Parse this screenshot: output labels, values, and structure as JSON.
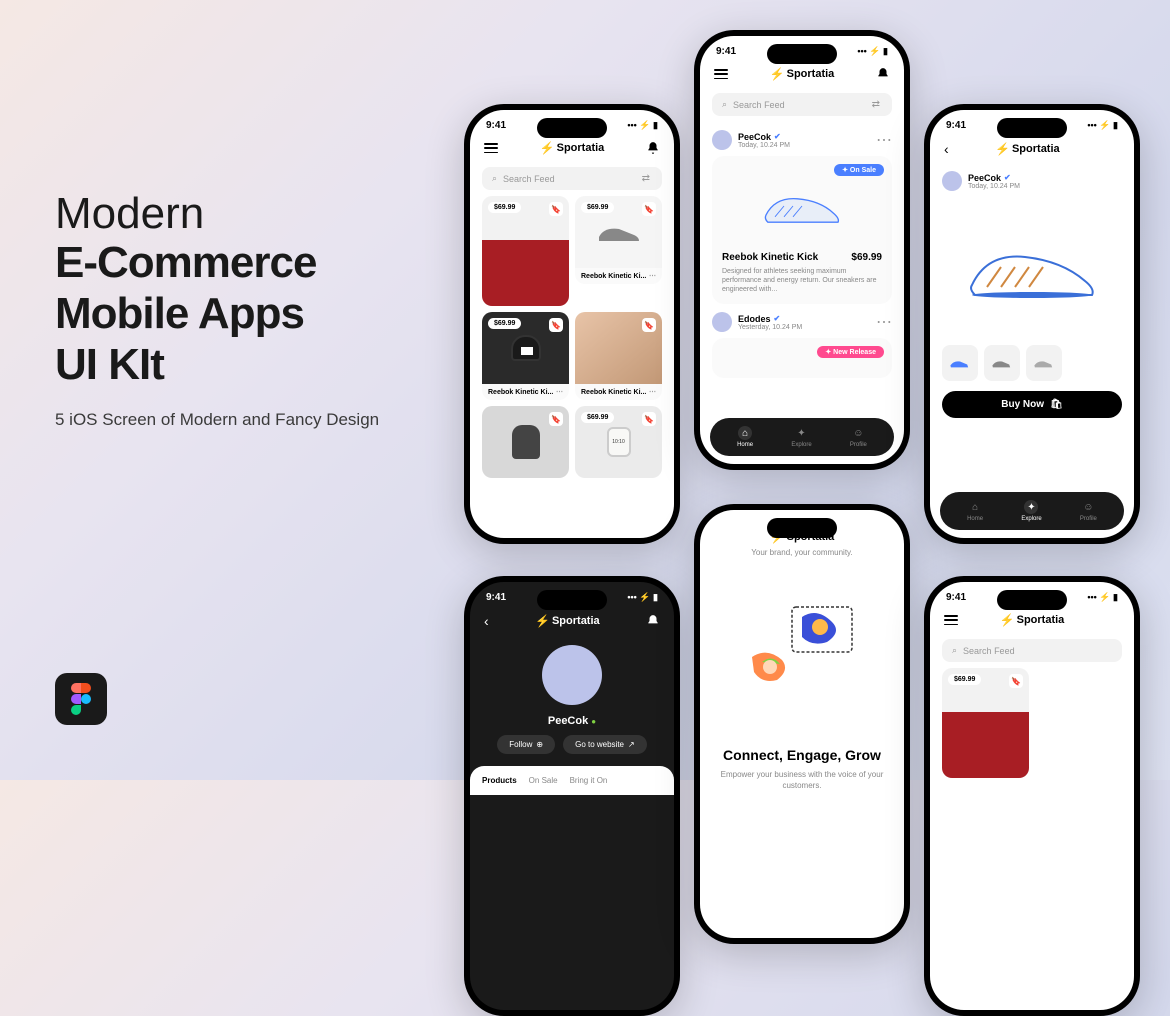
{
  "hero": {
    "line1": "Modern",
    "line2": "E-Commerce",
    "line3": "Mobile Apps",
    "line4": "UI KIt",
    "subtitle": "5 iOS Screen of Modern and Fancy Design"
  },
  "common": {
    "time": "9:41",
    "brand": "Sportatia",
    "search_placeholder": "Search Feed",
    "nav": {
      "home": "Home",
      "explore": "Explore",
      "profile": "Profile"
    }
  },
  "p1": {
    "cards": [
      {
        "price": "$69.99",
        "title": ""
      },
      {
        "price": "$69.99",
        "title": "Reebok Kinetic Ki..."
      },
      {
        "price": "$69.99",
        "title": "Reebok Kinetic Ki..."
      },
      {
        "price": "",
        "title": "Reebok Kinetic Ki..."
      },
      {
        "price": "",
        "title": ""
      },
      {
        "price": "$69.99",
        "title": ""
      }
    ]
  },
  "p2": {
    "user1": {
      "name": "PeeCok",
      "time": "Today, 10.24 PM"
    },
    "badge_sale": "✦ On Sale",
    "product": {
      "title": "Reebok Kinetic Kick",
      "price": "$69.99",
      "desc": "Designed for athletes seeking maximum performance and energy return. Our sneakers are engineered with..."
    },
    "user2": {
      "name": "Edodes",
      "time": "Yesterday, 10.24 PM"
    },
    "badge_release": "✦ New Release"
  },
  "p3": {
    "user": {
      "name": "PeeCok",
      "time": "Today, 10.24 PM"
    },
    "buy": "Buy Now"
  },
  "p4": {
    "name": "PeeCok",
    "follow": "Follow",
    "website": "Go to website",
    "tabs": [
      "Products",
      "On Sale",
      "Bring it On"
    ]
  },
  "p5": {
    "tagline": "Your brand, your community.",
    "title": "Connect, Engage, Grow",
    "desc": "Empower your business with the voice of your customers."
  },
  "p6": {
    "price": "$69.99"
  }
}
